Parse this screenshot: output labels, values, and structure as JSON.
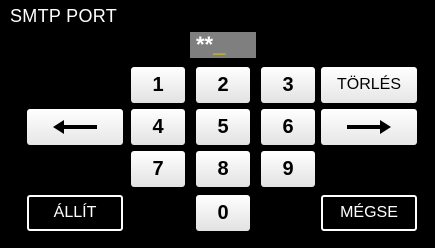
{
  "screen": {
    "title": "SMTP PORT"
  },
  "entry": {
    "value": "**",
    "cursor": "_"
  },
  "keypad": {
    "keys": [
      "1",
      "2",
      "3",
      "4",
      "5",
      "6",
      "7",
      "8",
      "9",
      "0"
    ]
  },
  "buttons": {
    "delete_label": "TÖRLÉS",
    "set_label": "ÁLLÍT",
    "cancel_label": "MÉGSE",
    "left_icon": "arrow-left-icon",
    "right_icon": "arrow-right-icon"
  },
  "colors": {
    "background": "#000000",
    "entry_bg": "#7f7f7f",
    "cursor": "#f2d000",
    "key_bg": "#ffffff"
  }
}
